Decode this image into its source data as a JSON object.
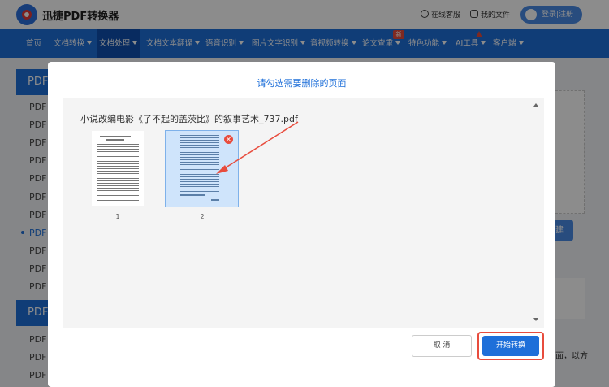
{
  "header": {
    "brand": "迅捷PDF转换器",
    "online_service": "在线客服",
    "my_files": "我的文件",
    "login": "登录|注册"
  },
  "nav": {
    "items": [
      "首页",
      "文档转换",
      "文档处理",
      "文档文本翻译",
      "语音识别",
      "图片文字识别",
      "音视频转换",
      "论文查重",
      "特色功能",
      "AI工具",
      "客户端"
    ],
    "badge_new": "新"
  },
  "sidebar": {
    "group1": "PDF",
    "group2": "PDF",
    "items": [
      "PDF",
      "PDF",
      "PDF",
      "PDF",
      "PDF",
      "PDF",
      "PDF",
      "PDF",
      "PDF",
      "PDF",
      "PDF"
    ],
    "bottom_items": [
      "PDF",
      "PDF",
      "PDF"
    ]
  },
  "background": {
    "button_fragment": "建",
    "text_fragment": "面，以方"
  },
  "modal": {
    "title": "请勾选需要删除的页面",
    "file_name": "小说改编电影《了不起的盖茨比》的叙事艺术_737.pdf",
    "pages": [
      {
        "number": "1",
        "selected": false
      },
      {
        "number": "2",
        "selected": true
      }
    ],
    "delete_icon": "✕",
    "cancel": "取 消",
    "start": "开始转换"
  },
  "colors": {
    "primary": "#1e6fd9",
    "highlight": "#e84c3d"
  }
}
